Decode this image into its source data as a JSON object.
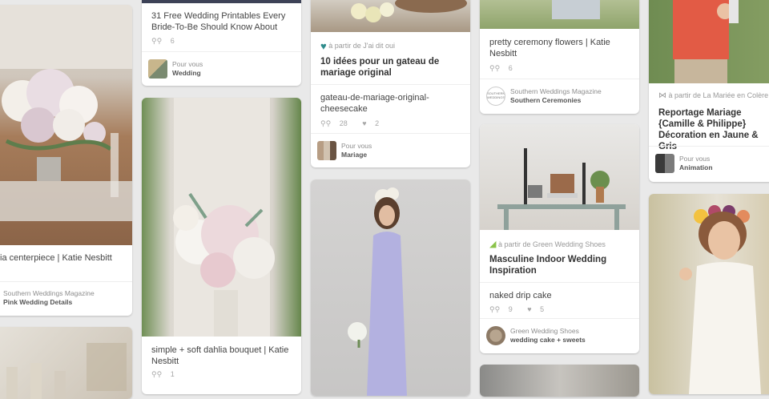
{
  "pins": [
    {
      "desc": "ia centerpiece | Katie Nesbitt",
      "footer_source": "Southern Weddings Magazine",
      "footer_board": "Pink Wedding Details"
    },
    {
      "desc": "31 Free Wedding Printables Every Bride-To-Be Should Know About",
      "repins": "6",
      "footer_source": "Pour vous",
      "footer_board": "Wedding"
    },
    {
      "desc": "simple + soft dahlia bouquet | Katie Nesbitt",
      "repins": "1"
    },
    {
      "source_line": "à partir de J'ai dit oui",
      "title": "10 idées pour un gateau de mariage original",
      "desc": "gateau-de-mariage-original-cheesecake",
      "repins": "28",
      "likes": "2",
      "footer_source": "Pour vous",
      "footer_board": "Mariage"
    },
    {
      "desc": "pretty ceremony flowers | Katie Nesbitt",
      "repins": "6",
      "footer_source": "Southern Weddings Magazine",
      "footer_board": "Southern Ceremonies",
      "avatar_text": "SOUTHERN WEDDINGS"
    },
    {
      "source_line": "à partir de Green Wedding Shoes",
      "title": "Masculine Indoor Wedding Inspiration",
      "desc": "naked drip cake",
      "repins": "9",
      "likes": "5",
      "footer_source": "Green Wedding Shoes",
      "footer_board": "wedding cake + sweets"
    },
    {
      "source_line": "à partir de La Mariée en Colère",
      "title": "Reportage Mariage {Camille & Philippe} Décoration en Jaune & Gris",
      "footer_source": "Pour vous",
      "footer_board": "Animation"
    }
  ],
  "colors": {
    "background": "#e9e9e9",
    "heart_teal": "#2e8b8b",
    "shoe_green": "#8bc34a"
  },
  "icons": {
    "repin": "pin-icon",
    "like": "heart-icon"
  }
}
